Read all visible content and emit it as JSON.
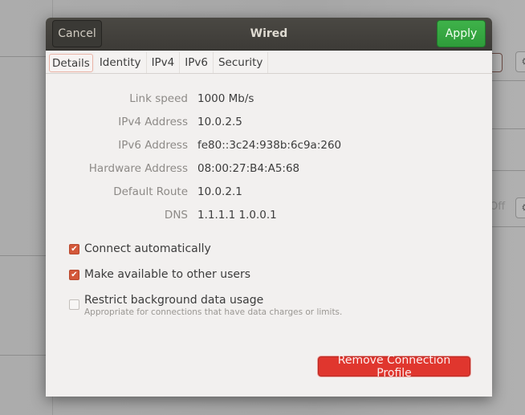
{
  "dialog": {
    "title": "Wired",
    "cancel_label": "Cancel",
    "apply_label": "Apply"
  },
  "tabs": [
    {
      "label": "Details",
      "active": true
    },
    {
      "label": "Identity",
      "active": false
    },
    {
      "label": "IPv4",
      "active": false
    },
    {
      "label": "IPv6",
      "active": false
    },
    {
      "label": "Security",
      "active": false
    }
  ],
  "details": [
    {
      "label": "Link speed",
      "value": "1000 Mb/s"
    },
    {
      "label": "IPv4 Address",
      "value": "10.0.2.5"
    },
    {
      "label": "IPv6 Address",
      "value": "fe80::3c24:938b:6c9a:260"
    },
    {
      "label": "Hardware Address",
      "value": "08:00:27:B4:A5:68"
    },
    {
      "label": "Default Route",
      "value": "10.0.2.1"
    },
    {
      "label": "DNS",
      "value": "1.1.1.1 1.0.0.1"
    }
  ],
  "options": [
    {
      "label": "Connect automatically",
      "checked": true
    },
    {
      "label": "Make available to other users",
      "checked": true
    },
    {
      "label": "Restrict background data usage",
      "checked": false,
      "sublabel": "Appropriate for connections that have data charges or limits."
    }
  ],
  "remove_label": "Remove Connection Profile",
  "background": {
    "off_text": "Off"
  },
  "colors": {
    "apply": "#2e9c3a",
    "remove": "#e0362e",
    "checkbox": "#d3583a",
    "headerbar": "#3d3b37"
  }
}
